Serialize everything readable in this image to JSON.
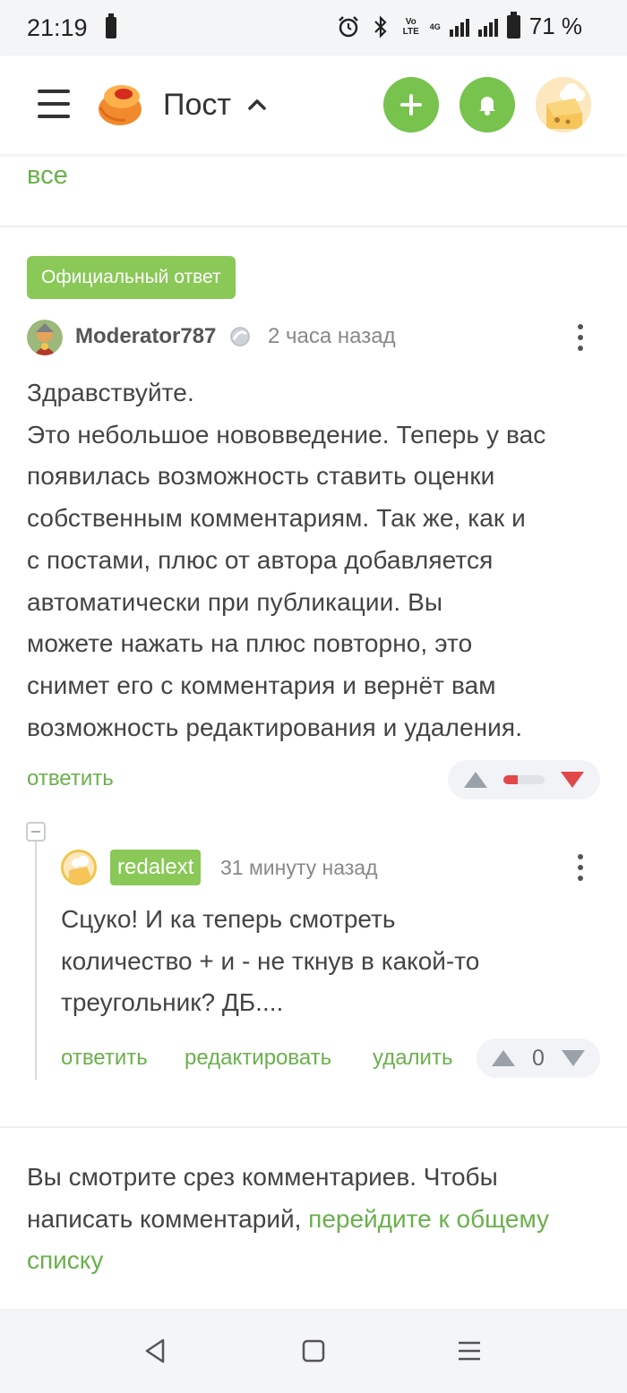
{
  "status_bar": {
    "time": "21:19",
    "network_label": "4G",
    "volte_label": "Vo LTE",
    "battery_percent": "71 %",
    "icons": [
      "battery-icon",
      "alarm-icon",
      "bluetooth-icon",
      "volte-icon",
      "signal-icon",
      "battery-icon"
    ]
  },
  "app_bar": {
    "title": "Пост",
    "icons": [
      "menu-icon",
      "pikabu-logo",
      "chevron-up-icon",
      "plus-icon",
      "bell-icon",
      "avatar"
    ],
    "accent_color": "#78c24e"
  },
  "top_link": "все",
  "official_comment": {
    "badge": "Официальный ответ",
    "author": "Moderator787",
    "time": "2 часа назад",
    "lines": [
      "Здравствуйте.",
      "Это небольшое нововведение. Теперь у вас",
      "появилась возможность ставить оценки",
      "собственным комментариям. Так же, как и",
      "с постами, плюс от автора добавляется",
      "автоматически при публикации. Вы",
      "можете нажать на плюс повторно, это",
      "снимет его с комментария и вернёт вам",
      "возможность редактирования и удаления."
    ],
    "reply_label": "ответить",
    "rating_negative_share": 0.35,
    "downvote_color": "#e0484a"
  },
  "reply_comment": {
    "author": "redalext",
    "time": "31 минуту назад",
    "lines": [
      "Сцуко! И ка теперь смотреть",
      "количество + и - не ткнув в какой-то",
      "треугольник? ДБ...."
    ],
    "reply_label": "ответить",
    "edit_label": "редактировать",
    "delete_label": "удалить",
    "score": "0"
  },
  "footer_note": {
    "text": "Вы смотрите срез комментариев. Чтобы написать комментарий, ",
    "link": "перейдите к общему списку"
  },
  "nav_bar": {
    "icons": [
      "back-icon",
      "home-icon",
      "recents-icon"
    ]
  }
}
